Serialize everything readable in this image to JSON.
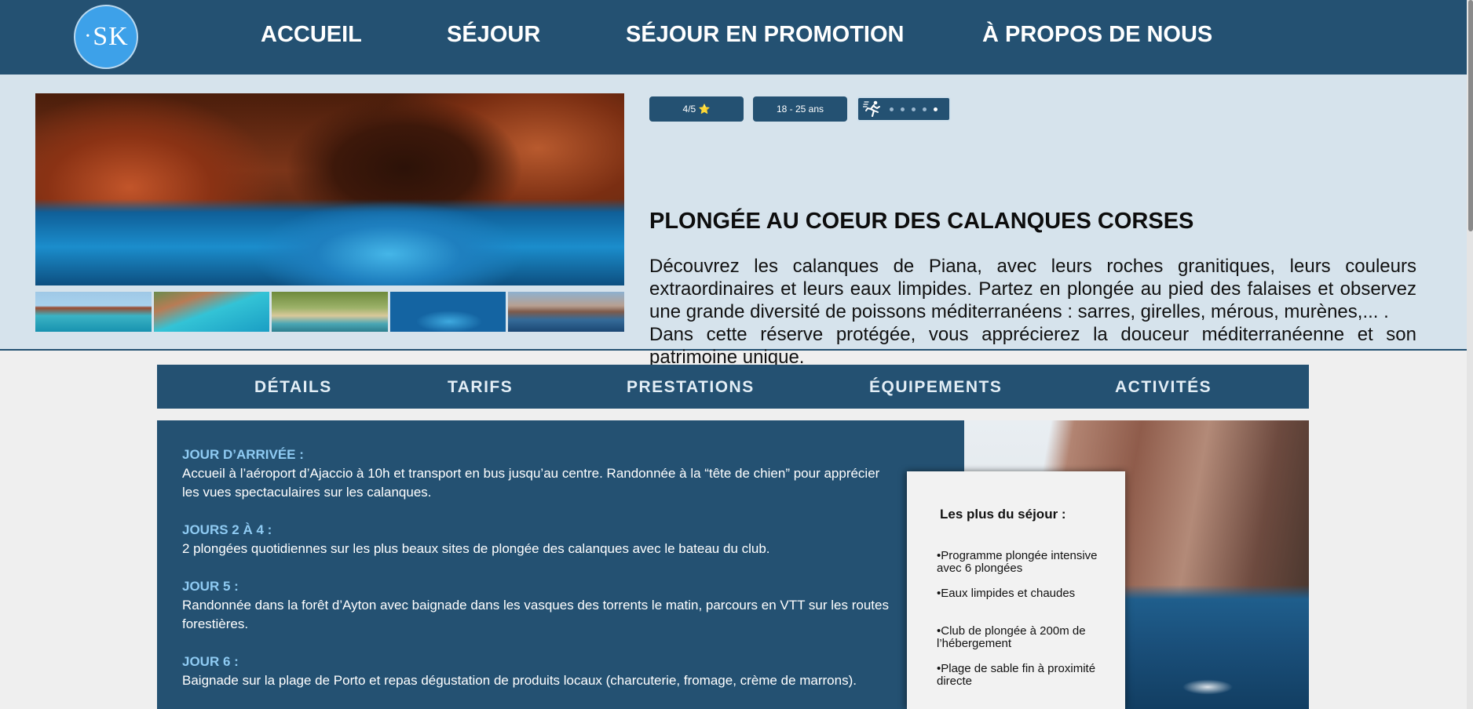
{
  "nav": {
    "logo_text": "SK",
    "links": [
      "ACCUEIL",
      "SÉJOUR",
      "SÉJOUR EN PROMOTION",
      "À PROPOS DE NOUS"
    ]
  },
  "hero": {
    "badges": {
      "rating": "4/5 ⭐",
      "age": "18 - 25 ans",
      "difficulty_icon": "running-person-icon",
      "difficulty_level": 5,
      "difficulty_max": 5
    },
    "title": "PLONGÉE AU COEUR DES CALANQUES CORSES",
    "text": "Découvrez les calanques de Piana, avec leurs roches granitiques, leurs couleurs extraordinaires et leurs eaux limpides. Partez en plongée au pied des falaises et observez une grande diversité de poissons méditerranéens : sarres, girelles, mérous, murènes,... .\nDans cette réserve protégée, vous apprécierez la douceur méditerranéenne et son patrimoine unique.",
    "thumbnails": 5
  },
  "tabs": [
    "DÉTAILS",
    "TARIFS",
    "PRESTATIONS",
    "ÉQUIPEMENTS",
    "ACTIVITÉS"
  ],
  "program": [
    {
      "title": "JOUR D’ARRIVÉE :",
      "text": "Accueil à l’aéroport d’Ajaccio à 10h et transport en bus jusqu’au centre. Randonnée à la “tête de chien” pour apprécier les vues spectaculaires sur les calanques."
    },
    {
      "title": "JOURS 2 À 4 :",
      "text": "2 plongées quotidiennes sur les plus beaux sites de plongée des calanques avec le bateau du club."
    },
    {
      "title": "JOUR 5 :",
      "text": "Randonnée dans la forêt d’Ayton avec baignade dans les vasques des torrents le matin, parcours en VTT sur les routes forestières."
    },
    {
      "title": "JOUR 6 :",
      "text": "Baignade sur la plage de Porto et repas dégustation de produits locaux (charcuterie, fromage, crème de marrons)."
    }
  ],
  "plus": {
    "title": "Les plus du séjour :",
    "items": [
      "•Programme plongée intensive avec 6 plongées",
      "•Eaux limpides et chaudes",
      "•Club de plongée à 200m de l’hébergement",
      "•Plage de sable fin à proximité directe"
    ]
  }
}
